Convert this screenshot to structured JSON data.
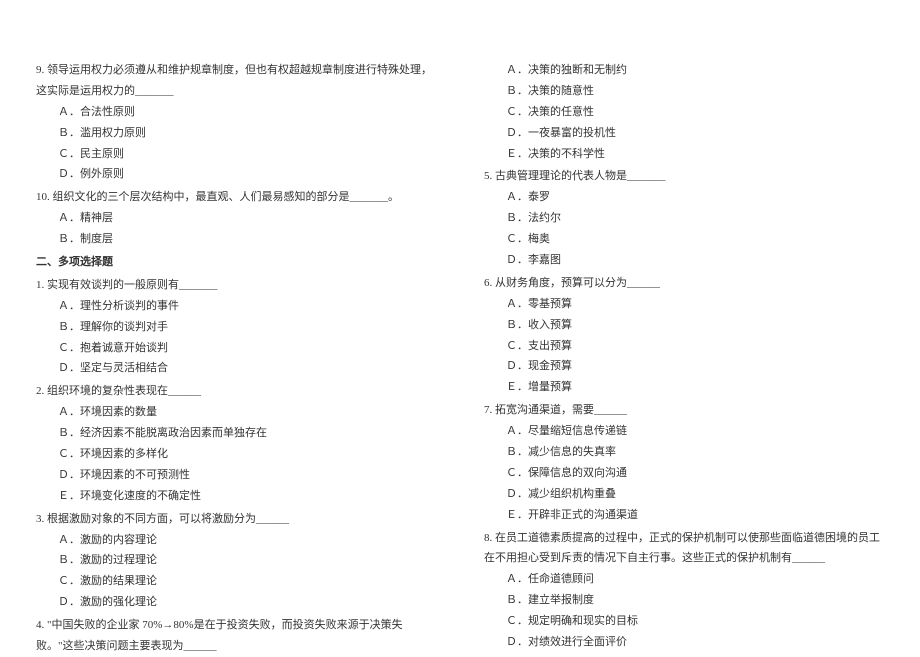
{
  "left": {
    "q9": {
      "stem": "9. 领导运用权力必须遵从和维护规章制度，但也有权超越规章制度进行特殊处理，这实际是运用权力的_______",
      "a": "Ａ．合法性原则",
      "b": "Ｂ．滥用权力原则",
      "c": "Ｃ．民主原则",
      "d": "Ｄ．例外原则"
    },
    "q10": {
      "stem": "10. 组织文化的三个层次结构中，最直观、人们最易感知的部分是_______。",
      "a": "Ａ．精神层",
      "b": "Ｂ．制度层"
    },
    "section2": "二、多项选择题",
    "m1": {
      "stem": "1. 实现有效谈判的一般原则有_______",
      "a": "Ａ．理性分析谈判的事件",
      "b": "Ｂ．理解你的谈判对手",
      "c": "Ｃ．抱着诚意开始谈判",
      "d": "Ｄ．坚定与灵活相结合"
    },
    "m2": {
      "stem": "2. 组织环境的复杂性表现在______",
      "a": "Ａ．环境因素的数量",
      "b": "Ｂ．经济因素不能脱离政治因素而单独存在",
      "c": "Ｃ．环境因素的多样化",
      "d": "Ｄ．环境因素的不可预测性",
      "e": "Ｅ．环境变化速度的不确定性"
    },
    "m3": {
      "stem": "3. 根据激励对象的不同方面，可以将激励分为______",
      "a": "Ａ．激励的内容理论",
      "b": "Ｂ．激励的过程理论",
      "c": "Ｃ．激励的结果理论",
      "d": "Ｄ．激励的强化理论"
    },
    "m4": {
      "stem": "4. \"中国失败的企业家 70%→80%是在于投资失败，而投资失败来源于决策失败。\"这些决策问题主要表现为______"
    }
  },
  "right": {
    "m4opts": {
      "a": "Ａ．决策的独断和无制约",
      "b": "Ｂ．决策的随意性",
      "c": "Ｃ．决策的任意性",
      "d": "Ｄ．一夜暴富的投机性",
      "e": "Ｅ．决策的不科学性"
    },
    "m5": {
      "stem": "5. 古典管理理论的代表人物是_______",
      "a": "Ａ．泰罗",
      "b": "Ｂ．法约尔",
      "c": "Ｃ．梅奥",
      "d": "Ｄ．李嘉图"
    },
    "m6": {
      "stem": "6. 从财务角度，预算可以分为______",
      "a": "Ａ．零基预算",
      "b": "Ｂ．收入预算",
      "c": "Ｃ．支出预算",
      "d": "Ｄ．现金预算",
      "e": "Ｅ．增量预算"
    },
    "m7": {
      "stem": "7. 拓宽沟通渠道，需要______",
      "a": "Ａ．尽量缩短信息传递链",
      "b": "Ｂ．减少信息的失真率",
      "c": "Ｃ．保障信息的双向沟通",
      "d": "Ｄ．减少组织机构重叠",
      "e": "Ｅ．开辟非正式的沟通渠道"
    },
    "m8": {
      "stem": "8. 在员工道德素质提高的过程中，正式的保护机制可以使那些面临道德困境的员工在不用担心受到斥责的情况下自主行事。这些正式的保护机制有______",
      "a": "Ａ．任命道德顾问",
      "b": "Ｂ．建立举报制度",
      "c": "Ｃ．规定明确和现实的目标",
      "d": "Ｄ．对绩效进行全面评价"
    }
  }
}
